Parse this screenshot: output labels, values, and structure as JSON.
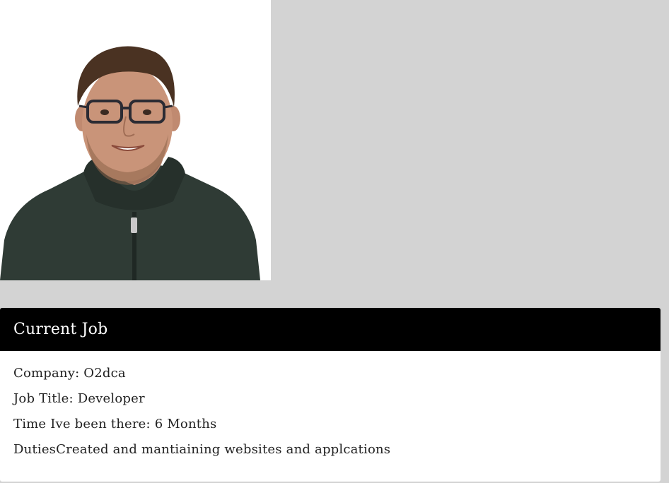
{
  "profile": {
    "photo_alt": "Profile photo",
    "colors": {
      "sweater": "#2f3b35",
      "hair": "#4a3222",
      "skin": "#c99479"
    }
  },
  "job_card": {
    "title": "Current Job",
    "company_line": "Company: O2dca",
    "job_title_line": "Job Title: Developer",
    "tenure_line": "Time Ive been there: 6 Months",
    "duties_line": "DutiesCreated and mantiaining websites and applcations"
  },
  "colors": {
    "page_background": "#d3d3d3",
    "card_header": "#000000",
    "card_body": "#ffffff"
  }
}
